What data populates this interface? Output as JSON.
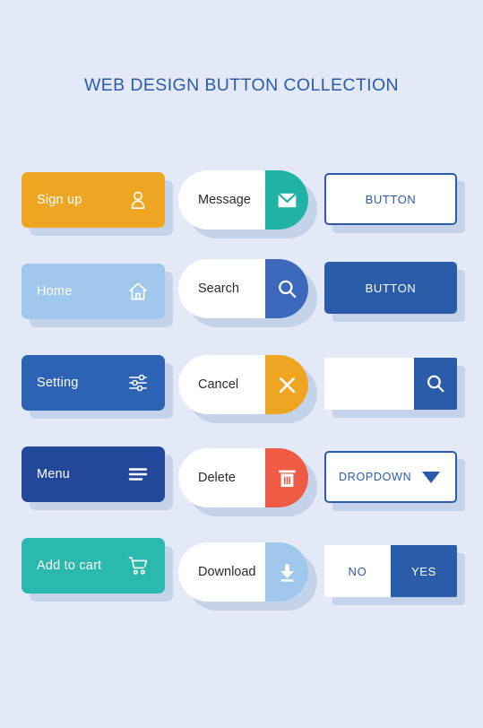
{
  "page": {
    "title": "WEB DESIGN BUTTON COLLECTION",
    "background_color": "#e4e9f7",
    "shadow_color": "#c5d3ea",
    "accent_blue": "#2a5caa"
  },
  "column_one": {
    "buttons": [
      {
        "label": "Sign up",
        "icon": "user-icon",
        "color": "#eda522"
      },
      {
        "label": "Home",
        "icon": "home-icon",
        "color": "#9fc8ec"
      },
      {
        "label": "Setting",
        "icon": "sliders-icon",
        "color": "#2c63b5"
      },
      {
        "label": "Menu",
        "icon": "hamburger-icon",
        "color": "#23479b"
      },
      {
        "label": "Add to cart",
        "icon": "cart-icon",
        "color": "#2bb8ae"
      }
    ]
  },
  "column_two": {
    "buttons": [
      {
        "label": "Message",
        "icon": "envelope-icon",
        "color": "#21b2a6"
      },
      {
        "label": "Search",
        "icon": "magnifier-icon",
        "color": "#3b68ba"
      },
      {
        "label": "Cancel",
        "icon": "close-x-icon",
        "color": "#eda522"
      },
      {
        "label": "Delete",
        "icon": "trash-icon",
        "color": "#ef5b44"
      },
      {
        "label": "Download",
        "icon": "download-arrow-icon",
        "color": "#9fc8ec"
      }
    ]
  },
  "column_three": {
    "outline_button": {
      "label": "BUTTON"
    },
    "filled_button": {
      "label": "BUTTON"
    },
    "search_field": {
      "value": "",
      "placeholder": "",
      "icon": "magnifier-icon"
    },
    "dropdown": {
      "label": "DROPDOWN",
      "icon": "caret-down-icon"
    },
    "toggle": {
      "off_label": "NO",
      "on_label": "YES",
      "selected": "YES"
    }
  }
}
